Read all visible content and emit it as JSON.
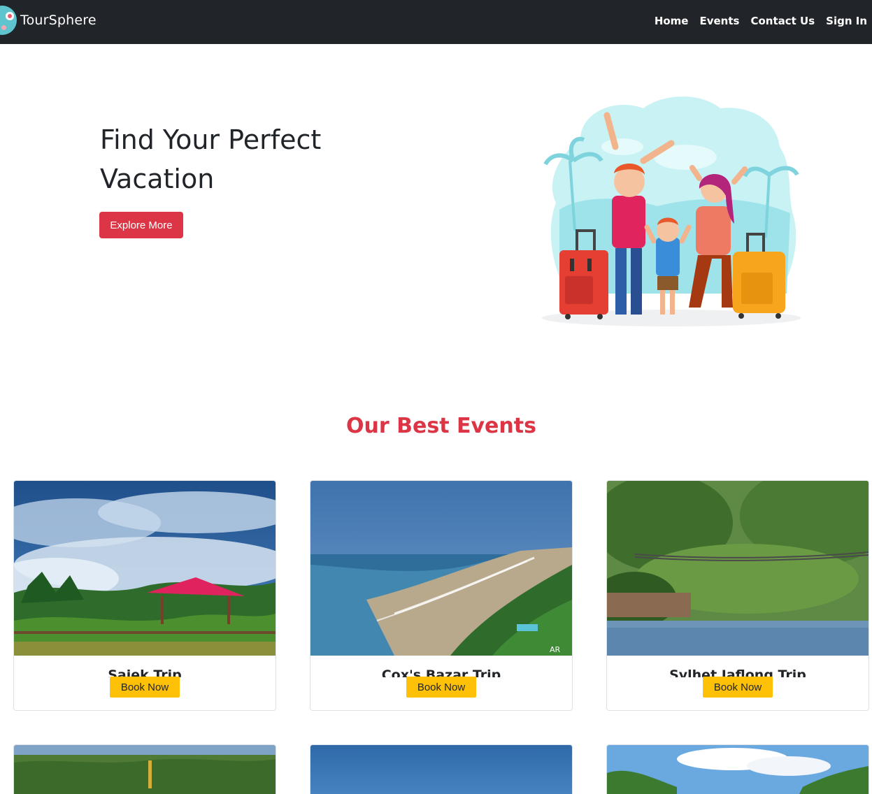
{
  "navbar": {
    "brand": "TourSphere",
    "links": [
      "Home",
      "Events",
      "Contact Us",
      "Sign In"
    ]
  },
  "hero": {
    "title": "Find Your Perfect Vacation",
    "button_label": "Explore More"
  },
  "events": {
    "title": "Our Best Events",
    "cards": [
      {
        "title": "Sajek Trip",
        "button_label": "Book Now"
      },
      {
        "title": "Cox's Bazar Trip",
        "button_label": "Book Now"
      },
      {
        "title": "Sylhet Jaflong Trip",
        "button_label": "Book Now"
      }
    ]
  },
  "colors": {
    "navbar_bg": "#212529",
    "accent_red": "#dc3545",
    "book_yellow": "#ffc107"
  }
}
